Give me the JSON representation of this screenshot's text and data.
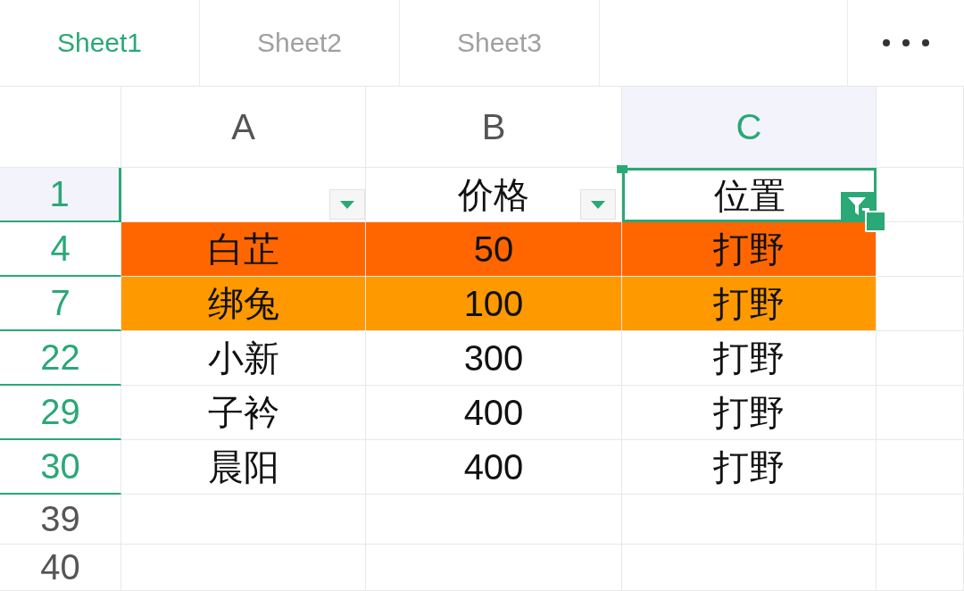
{
  "tabs": [
    {
      "label": "Sheet1",
      "selected": true
    },
    {
      "label": "Sheet2",
      "selected": false
    },
    {
      "label": "Sheet3",
      "selected": false
    }
  ],
  "columns": [
    {
      "label": "A",
      "selected": false
    },
    {
      "label": "B",
      "selected": false
    },
    {
      "label": "C",
      "selected": true
    }
  ],
  "header_row": {
    "label": "1",
    "selected": true,
    "filtered": true,
    "cells": [
      {
        "text": "",
        "filter_active": false,
        "selected": false
      },
      {
        "text": "价格",
        "filter_active": false,
        "selected": false
      },
      {
        "text": "位置",
        "filter_active": true,
        "selected": true
      }
    ]
  },
  "rows": [
    {
      "label": "4",
      "filtered": true,
      "color": "#ff6600",
      "cells": [
        "白芷",
        "50",
        "打野"
      ]
    },
    {
      "label": "7",
      "filtered": true,
      "color": "#ff9900",
      "cells": [
        "绑兔",
        "100",
        "打野"
      ]
    },
    {
      "label": "22",
      "filtered": true,
      "cells": [
        "小新",
        "300",
        "打野"
      ]
    },
    {
      "label": "29",
      "filtered": true,
      "cells": [
        "子衿",
        "400",
        "打野"
      ]
    },
    {
      "label": "30",
      "filtered": true,
      "cells": [
        "晨阳",
        "400",
        "打野"
      ]
    },
    {
      "label": "39",
      "filtered": false
    },
    {
      "label": "40",
      "filtered": false
    }
  ]
}
